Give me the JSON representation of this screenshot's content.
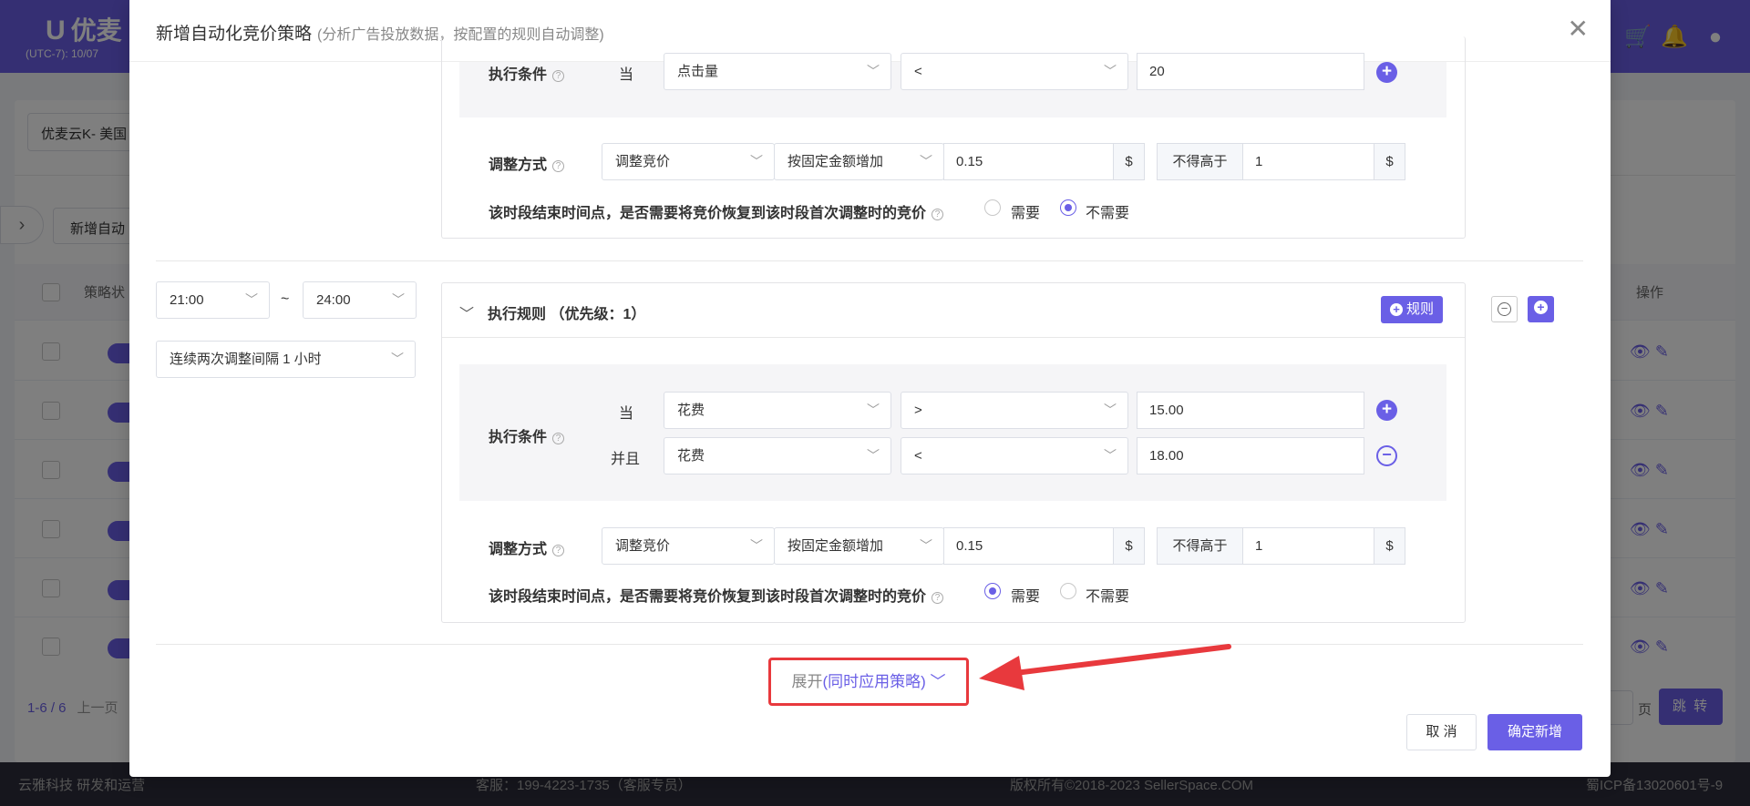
{
  "background": {
    "app_logo": "优麦",
    "timezone": "(UTC-7): 10/07",
    "shop_select": "优麦云K- 美国",
    "new_button": "新增自动",
    "col_status": "策略状",
    "col_ops": "操作",
    "pager": "1-6 / 6",
    "pager_prev": "上一页",
    "page_label": "页",
    "jump_label": "跳 转",
    "footer_left": "云雅科技 研发和运营",
    "footer_service": "客服：199-4223-1735（客服专员）",
    "footer_copyright": "版权所有©2018-2023 SellerSpace.COM",
    "footer_icp": "蜀ICP备13020601号-9"
  },
  "modal": {
    "title": "新增自动化竞价策略",
    "subtitle": "(分析广告投放数据，按配置的规则自动调整)",
    "block1": {
      "cond_label": "执行条件",
      "when": "当",
      "field": "点击量",
      "op": "<",
      "value": "20",
      "adjust_label": "调整方式",
      "adjust_type": "调整竞价",
      "adjust_method": "按固定金额增加",
      "amount": "0.15",
      "currency": "$",
      "limit_label": "不得高于",
      "limit_value": "1",
      "limit_currency": "$",
      "restore_question": "该时段结束时间点，是否需要将竞价恢复到该时段首次调整时的竞价",
      "opt_yes": "需要",
      "opt_no": "不需要",
      "restore_selected": "不需要"
    },
    "time_block": {
      "start_time": "21:00",
      "tilde": "~",
      "end_time": "24:00",
      "interval": "连续两次调整间隔 1 小时"
    },
    "block2": {
      "rule_header": "执行规则 （优先级：1）",
      "rule_button": "规则",
      "cond_label": "执行条件",
      "row1": {
        "conj": "当",
        "field": "花费",
        "op": ">",
        "value": "15.00"
      },
      "row2": {
        "conj": "并且",
        "field": "花费",
        "op": "<",
        "value": "18.00"
      },
      "adjust_label": "调整方式",
      "adjust_type": "调整竞价",
      "adjust_method": "按固定金额增加",
      "amount": "0.15",
      "currency": "$",
      "limit_label": "不得高于",
      "limit_value": "1",
      "limit_currency": "$",
      "restore_question": "该时段结束时间点，是否需要将竞价恢复到该时段首次调整时的竞价",
      "opt_yes": "需要",
      "opt_no": "不需要",
      "restore_selected": "需要"
    },
    "expand_prefix": "展开",
    "expand_link": "(同时应用策略)",
    "cancel": "取 消",
    "confirm": "确定新增"
  },
  "colors": {
    "accent": "#6a5fe6",
    "highlight": "#e8393d"
  }
}
